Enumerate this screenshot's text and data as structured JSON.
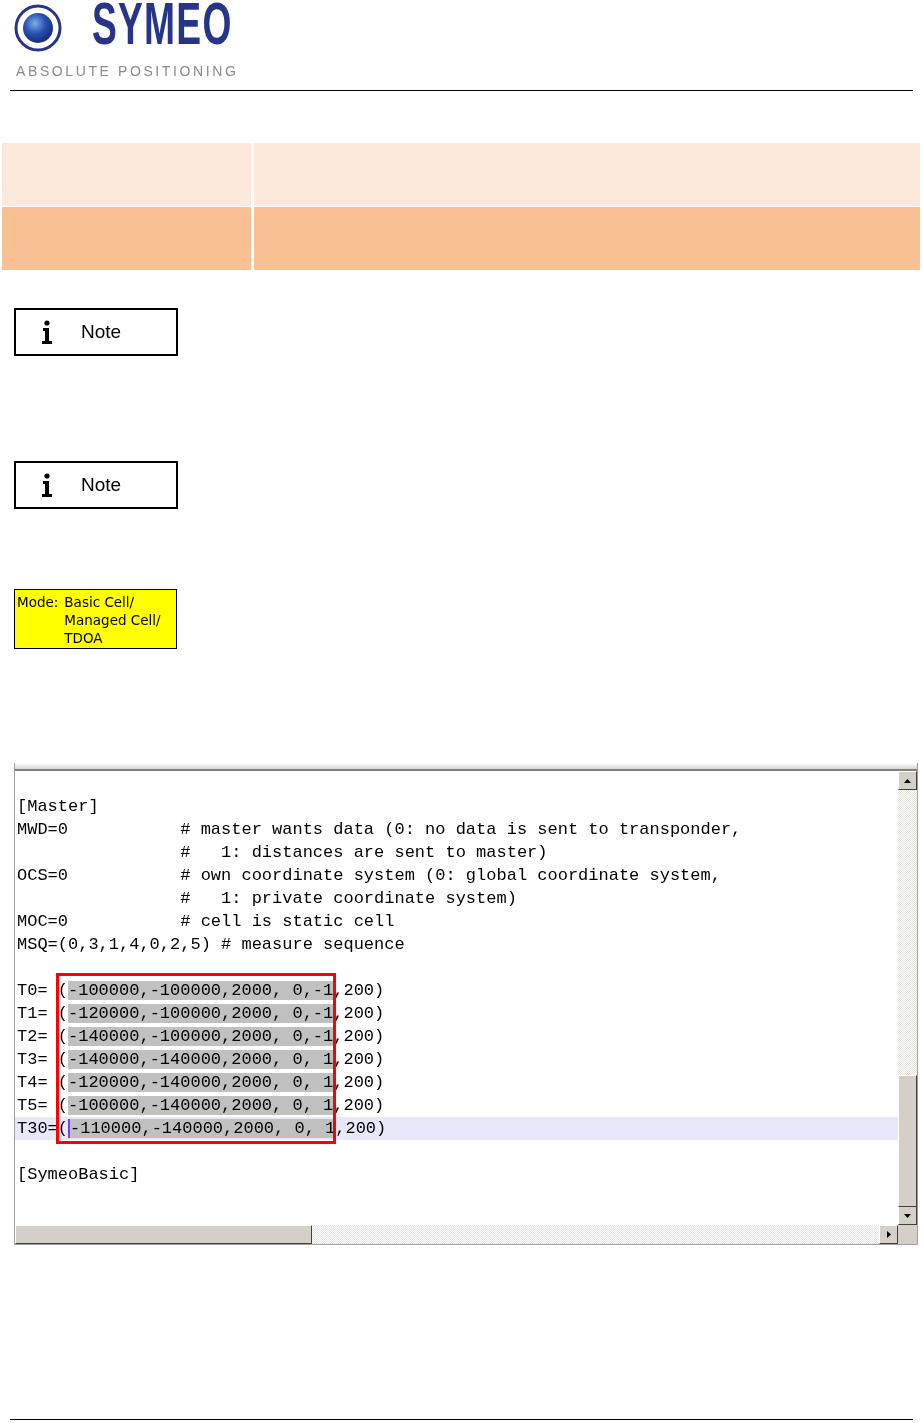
{
  "header": {
    "logo_name": "SYMEO",
    "logo_tagline": "ABSOLUTE POSITIONING"
  },
  "notes": [
    {
      "label": "Note"
    },
    {
      "label": "Note"
    }
  ],
  "mode_tag": {
    "label": "Mode:",
    "values": [
      "Basic Cell/",
      "Managed Cell/",
      "TDOA"
    ]
  },
  "editor": {
    "lines": [
      {
        "kind": "text",
        "text": "[Master]",
        "current": false
      },
      {
        "kind": "text",
        "text": "MWD=0           # master wants data (0: no data is sent to transponder,",
        "current": false
      },
      {
        "kind": "text",
        "text": "                #   1: distances are sent to master)",
        "current": false
      },
      {
        "kind": "text",
        "text": "OCS=0           # own coordinate system (0: global coordinate system,",
        "current": false
      },
      {
        "kind": "text",
        "text": "                #   1: private coordinate system)",
        "current": false
      },
      {
        "kind": "text",
        "text": "MOC=0           # cell is static cell",
        "current": false
      },
      {
        "kind": "text",
        "text": "MSQ=(0,3,1,4,0,2,5) # measure sequence",
        "current": false
      },
      {
        "kind": "blank"
      },
      {
        "kind": "entry",
        "prefix": "T0= (",
        "selected_text": "-100000,-100000,2000, 0,-1",
        "suffix": ",200)",
        "current": false
      },
      {
        "kind": "entry",
        "prefix": "T1= (",
        "selected_text": "-120000,-100000,2000, 0,-1",
        "suffix": ",200)",
        "current": false
      },
      {
        "kind": "entry",
        "prefix": "T2= (",
        "selected_text": "-140000,-100000,2000, 0,-1",
        "suffix": ",200)",
        "current": false
      },
      {
        "kind": "entry",
        "prefix": "T3= (",
        "selected_text": "-140000,-140000,2000, 0, 1",
        "suffix": ",200)",
        "current": false
      },
      {
        "kind": "entry",
        "prefix": "T4= (",
        "selected_text": "-120000,-140000,2000, 0, 1",
        "suffix": ",200)",
        "current": false
      },
      {
        "kind": "entry",
        "prefix": "T5= (",
        "selected_text": "-100000,-140000,2000, 0, 1",
        "suffix": ",200)",
        "current": false
      },
      {
        "kind": "entry",
        "prefix": "T30=(",
        "selected_text": "-110000,-140000,2000, 0, 1",
        "suffix": ",200)",
        "current": true
      },
      {
        "kind": "blank"
      },
      {
        "kind": "text",
        "text": "[SymeoBasic]",
        "current": false
      }
    ]
  }
}
